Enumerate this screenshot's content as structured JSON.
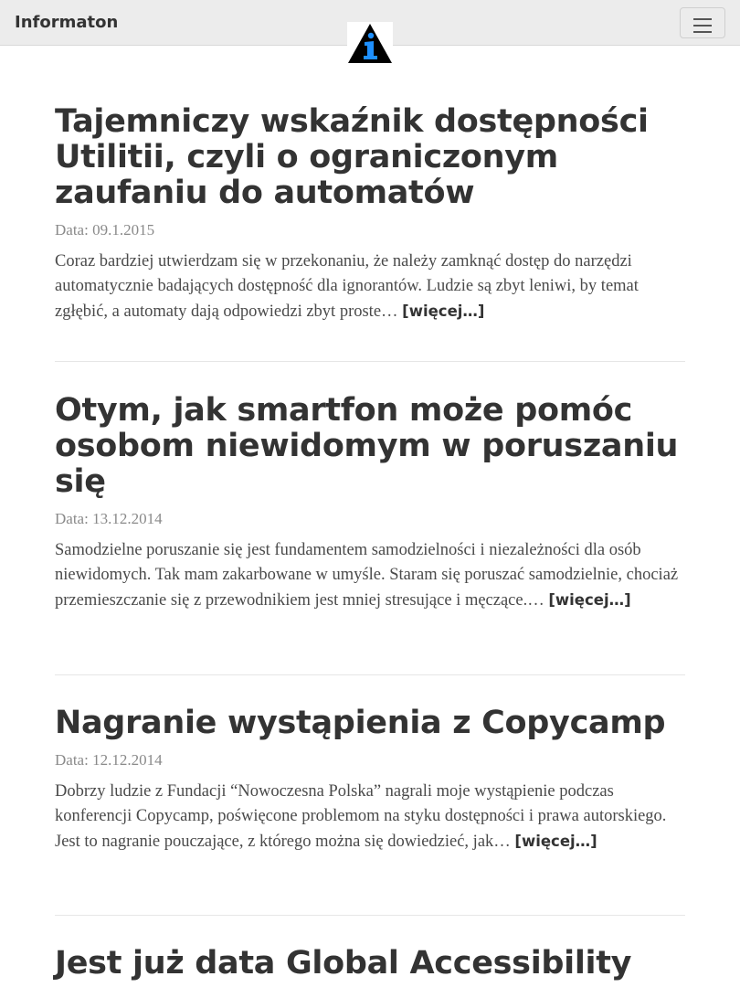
{
  "header": {
    "brand": "Informaton",
    "logo_icon": "info-triangle-logo",
    "menu_icon": "hamburger-menu-icon",
    "colors": {
      "navbar_bg": "#ececec",
      "logo_triangle": "#000000",
      "logo_i": "#1e90ff"
    }
  },
  "posts": [
    {
      "title": "Tajemniczy wskaźnik dostępności Utilitii, czyli o ograniczonym zaufaniu do automatów",
      "date": "Data: 09.1.2015",
      "excerpt": "Coraz bardziej utwierdzam się w przekonaniu, że należy zamknąć dostęp do narzędzi automatycznie badających dostępność dla ignorantów. Ludzie są zbyt leniwi, by temat zgłębić, a automaty dają odpowiedzi zbyt proste…",
      "more": "[więcej…]"
    },
    {
      "title": "Otym, jak smartfon może pomóc osobom niewidomym w poruszaniu się",
      "date": "Data: 13.12.2014",
      "excerpt": "Samodzielne poruszanie się jest fundamentem samodzielności i niezależności dla osób niewidomych. Tak mam zakarbowane w umyśle. Staram się poruszać samodzielnie, chociaż przemieszczanie się z przewodnikiem jest mniej stresujące i męczące.…",
      "more": "[więcej…]"
    },
    {
      "title": "Nagranie wystąpienia z Copycamp",
      "date": "Data: 12.12.2014",
      "excerpt": "Dobrzy ludzie z Fundacji “Nowoczesna Polska” nagrali moje wystąpienie podczas konferencji Copycamp, poświęcone problemom na styku dostępności i prawa autorskiego. Jest to nagranie pouczające, z którego można się dowiedzieć, jak…",
      "more": "[więcej…]"
    },
    {
      "title": "Jest już data Global Accessibility"
    }
  ]
}
